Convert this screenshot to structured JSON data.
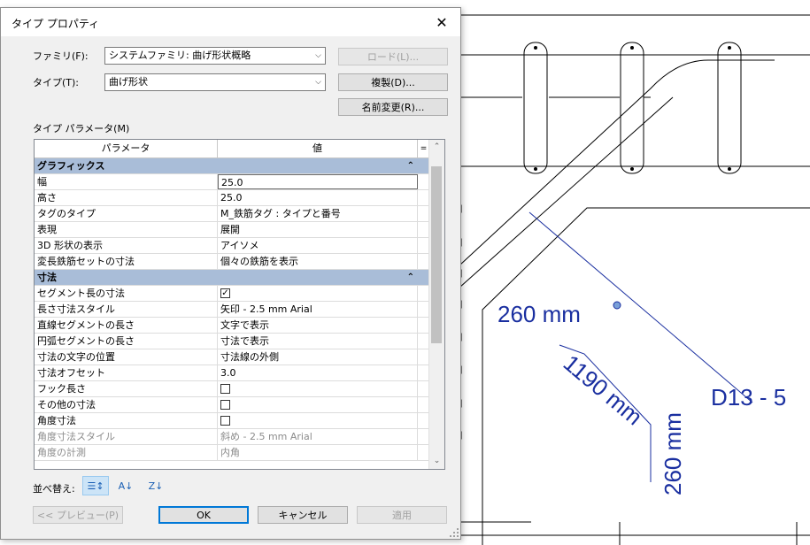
{
  "dialog": {
    "title": "タイプ プロパティ",
    "family_label": "ファミリ(F):",
    "family_value": "システムファミリ: 曲げ形状概略",
    "type_label": "タイプ(T):",
    "type_value": "曲げ形状",
    "load_button": "ロード(L)...",
    "duplicate_button": "複製(D)...",
    "rename_button": "名前変更(R)...",
    "type_params_label": "タイプ パラメータ(M)",
    "col_param": "パラメータ",
    "col_value": "値",
    "groups": [
      {
        "name": "グラフィックス",
        "rows": [
          {
            "p": "幅",
            "v": "25.0"
          },
          {
            "p": "高さ",
            "v": "25.0"
          },
          {
            "p": "タグのタイプ",
            "v": "M_鉄筋タグ : タイプと番号"
          },
          {
            "p": "表現",
            "v": "展開"
          },
          {
            "p": "3D 形状の表示",
            "v": "アイソメ"
          },
          {
            "p": "変長鉄筋セットの寸法",
            "v": "個々の鉄筋を表示"
          }
        ]
      },
      {
        "name": "寸法",
        "rows": [
          {
            "p": "セグメント長の寸法",
            "v": ""
          },
          {
            "p": "長さ寸法スタイル",
            "v": "矢印 - 2.5 mm Arial"
          },
          {
            "p": "直線セグメントの長さ",
            "v": "文字で表示"
          },
          {
            "p": "円弧セグメントの長さ",
            "v": "寸法で表示"
          },
          {
            "p": "寸法の文字の位置",
            "v": "寸法線の外側"
          },
          {
            "p": "寸法オフセット",
            "v": "3.0"
          },
          {
            "p": "フック長さ",
            "v": ""
          },
          {
            "p": "その他の寸法",
            "v": ""
          },
          {
            "p": "角度寸法",
            "v": ""
          },
          {
            "p": "角度寸法スタイル",
            "v": "斜め - 2.5 mm Arial"
          },
          {
            "p": "角度の計測",
            "v": "内角"
          }
        ]
      }
    ],
    "sort_label": "並べ替え:",
    "preview_button": "<< プレビュー(P)",
    "ok_button": "OK",
    "cancel_button": "キャンセル",
    "apply_button": "適用"
  },
  "drawing": {
    "dim_a": "260 mm",
    "dim_b": "1190 mm",
    "dim_c": "260 mm",
    "tag": "D13 - 5",
    "edge_text": "m"
  },
  "colors": {
    "annotation_blue": "#1a2fa0",
    "group_header": "#a9bdd8"
  }
}
